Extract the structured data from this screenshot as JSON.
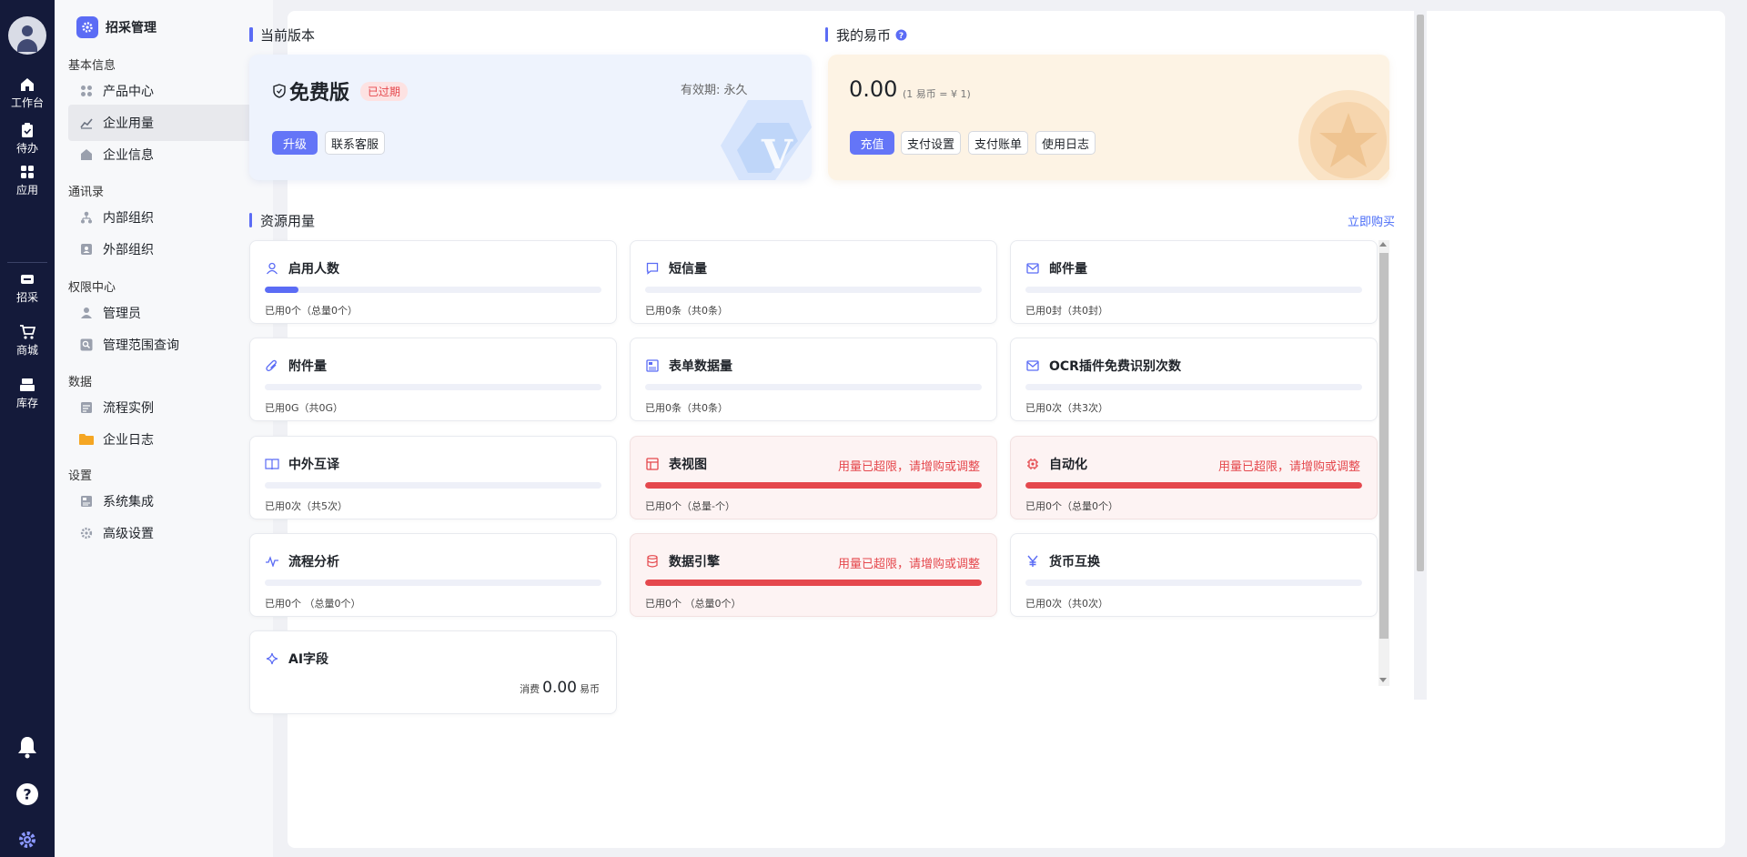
{
  "rail": {
    "items": [
      {
        "label": "工作台",
        "icon": "home-icon"
      },
      {
        "label": "待办",
        "icon": "clipboard-check-icon"
      },
      {
        "label": "应用",
        "icon": "apps-grid-icon"
      },
      {
        "label": "招采",
        "icon": "procurement-icon"
      },
      {
        "label": "商城",
        "icon": "cart-icon"
      },
      {
        "label": "库存",
        "icon": "inventory-icon"
      }
    ]
  },
  "sidebar": {
    "title": "招采管理",
    "groups": [
      {
        "label": "基本信息",
        "items": [
          "产品中心",
          "企业用量",
          "企业信息"
        ]
      },
      {
        "label": "通讯录",
        "items": [
          "内部组织",
          "外部组织"
        ]
      },
      {
        "label": "权限中心",
        "items": [
          "管理员",
          "管理范围查询"
        ]
      },
      {
        "label": "数据",
        "items": [
          "流程实例",
          "企业日志"
        ]
      },
      {
        "label": "设置",
        "items": [
          "系统集成",
          "高级设置"
        ]
      }
    ],
    "active_item": "企业用量"
  },
  "version": {
    "section_title": "当前版本",
    "name": "免费版",
    "status": "已过期",
    "validity": "有效期: 永久",
    "upgrade_label": "升级",
    "contact_label": "联系客服"
  },
  "coins": {
    "section_title": "我的易币",
    "balance": "0.00",
    "rate": "(1 易币 = ¥ 1)",
    "buttons": [
      "充值",
      "支付设置",
      "支付账单",
      "使用日志"
    ]
  },
  "resources": {
    "section_title": "资源用量",
    "buy_label": "立即购买",
    "warn_text": "用量已超限，请增购或调整",
    "cards": [
      {
        "title": "启用人数",
        "icon": "user-icon",
        "used": "已用0个（总量0个）",
        "progress": 0.1,
        "over": false
      },
      {
        "title": "短信量",
        "icon": "message-icon",
        "used": "已用0条（共0条）",
        "progress": 0,
        "over": false
      },
      {
        "title": "邮件量",
        "icon": "mail-icon",
        "used": "已用0封（共0封）",
        "progress": 0,
        "over": false
      },
      {
        "title": "附件量",
        "icon": "paperclip-icon",
        "used": "已用0G（共0G）",
        "progress": 0,
        "over": false
      },
      {
        "title": "表单数据量",
        "icon": "form-icon",
        "used": "已用0条（共0条）",
        "progress": 0,
        "over": false
      },
      {
        "title": "OCR插件免费识别次数",
        "icon": "mail-icon",
        "used": "已用0次（共3次）",
        "progress": 0,
        "over": false
      },
      {
        "title": "中外互译",
        "icon": "book-icon",
        "used": "已用0次（共5次）",
        "progress": 0,
        "over": false
      },
      {
        "title": "表视图",
        "icon": "table-view-icon",
        "used": "已用0个（总量-个）",
        "progress": 1,
        "over": true
      },
      {
        "title": "自动化",
        "icon": "chip-icon",
        "used": "已用0个（总量0个）",
        "progress": 1,
        "over": true
      },
      {
        "title": "流程分析",
        "icon": "pulse-icon",
        "used": "已用0个 （总量0个）",
        "progress": 0,
        "over": false
      },
      {
        "title": "数据引擎",
        "icon": "database-icon",
        "used": "已用0个 （总量0个）",
        "progress": 1,
        "over": true
      },
      {
        "title": "货币互换",
        "icon": "yen-icon",
        "used": "已用0次（共0次）",
        "progress": 0,
        "over": false
      },
      {
        "title": "AI字段",
        "icon": "sparkle-icon",
        "consume_prefix": "消费",
        "consume_value": "0.00",
        "consume_unit": "易币",
        "over": false
      }
    ]
  },
  "colors": {
    "accent": "#5b6cf5",
    "danger": "#e5484d",
    "rail": "#141a3a"
  }
}
